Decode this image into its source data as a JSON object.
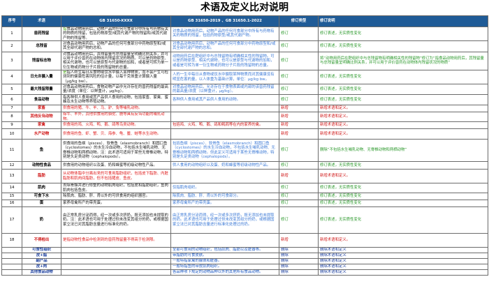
{
  "page": {
    "title": "术语及定义比对说明"
  },
  "headers": {
    "no": "序号",
    "term": "术语",
    "new_std": "GB 31650-XXXX",
    "old_std": "GB 31650-2019 、GB 31650.1-2022",
    "type": "修订类型",
    "note": "修订说明"
  },
  "colors": {
    "header_bg": "#1f5b97",
    "keyword_green": "#4ea81e",
    "added_red": "#d01818",
    "deleted_blue": "#1a3e9e",
    "modified_green": "#2e9a2e"
  },
  "rows": [
    {
      "no": "1",
      "term": "兽药残留",
      "new_pre": "",
      "new_kw": "指",
      "new_txt": "食品动物用药后，动物产品的任何可食部分中所有与药物有关的物质的残留，包括药物原型/或其代谢产物的残留和/或其代谢产物的残留等。",
      "old": "对食品动物用药后，动物产品的任何可食部分中所有与药物有关的物质的残留，包括药物原型/或其代谢产物。",
      "type": "修订",
      "note": "修订表述，无实质性变化",
      "status": "mod",
      "h": 13
    },
    {
      "no": "2",
      "term": "总残留",
      "new_pre": "",
      "new_kw": "",
      "new_txt": "对食品动物用药后，动物产品的任何可食部分中药物原型和/或其全部代谢产物的总和。",
      "old": "对食品动物用药后，动物产品的任何可食部分中药物原型和/或其全部代谢产物的总和。",
      "type": "修订",
      "note": "修订表述，无实质性变化",
      "status": "mod",
      "h": 14
    },
    {
      "no": "3",
      "term": "残留标志物",
      "new_pre": "",
      "new_kw": "",
      "new_txt": "对食品动物用药后，其残留量与总残留量呈明确比例关系，并可以用于评价兽药在动物体内残留状况的物质。可以是药物原型、相关代谢物，也可以是原型与代谢物的加和，或者是可转为单一衍生物或药物分子片段的残留物的总量。",
      "old": "动物用药后在靶组织中与总残留物有明确相关性的残留物。可以是药物原型、相关代谢物，也可以是原型与代谢物的加和，或者是可转为单一衍生物或药物分子片段的残留物的总量。",
      "type": "修订",
      "note": "将“动物用药后在靶组织中与总残留物有明确相关性的残留物”修订为“指食品动物用药后，其残留量与总残留量呈明确比例关系，并可以用于评价兽药在动物体内残留状况的物质”",
      "status": "mod",
      "h": 24
    },
    {
      "no": "4",
      "term": "日允许摄入量",
      "new_pre": "",
      "new_kw": "是",
      "new_txt": "指人终生每日从食物或饮水中摄入某种物质，而不会产生可检测到的健康危害风险的估计量，以每千克体重计算摄入量（μg/kg bw）。",
      "old": "人的一生中每日从食物或饮水中摄取某种物质而对其健康没有明显危害的量，以人体重为基础计算，单位：μg/kg bw。",
      "type": "修订",
      "note": "修订表述，无实质性变化",
      "status": "mod",
      "h": 18
    },
    {
      "no": "5",
      "term": "最大残留限量",
      "new_pre": "",
      "new_kw": "",
      "new_txt": "对食品动物用药后，食物动物产品中允许存在的兽药残留的最高量/浓度（单位：以鲜重计，μg/kg）。",
      "old": "对食品动物用药后，允许存在于食物表面或内部的该兽药残留的最高量/浓度（以鲜重计，μg/kg）。",
      "type": "修订",
      "note": "修订表述，无实质性变化",
      "status": "mod",
      "h": 13
    },
    {
      "no": "6",
      "term": "食品动物",
      "new_pre": "",
      "new_kw": "",
      "new_txt": "指各种供人食用或其产品供人食用的动物，包括家畜、家禽、蜜蜂及水生动物等养殖动物。",
      "old": "各种供人食用或其产品供人食用的动物。",
      "type": "修订",
      "note": "修订表述，无实质性变化",
      "status": "mod",
      "h": 13
    },
    {
      "no": "7",
      "term": "家畜",
      "new_pre": "",
      "new_kw": "",
      "new_txt": "供食用的猪、牛、羊、马、驴、兔等哺乳动物。",
      "old": "",
      "type": "新增",
      "note": "新增术语和定义。",
      "status": "new",
      "h": 8
    },
    {
      "no": "8",
      "term": "其他反刍动物",
      "new_pre": "",
      "new_kw": "",
      "new_txt": "除牛、羊外，其他供食用的骆驼、鹿等具有反刍功能的哺乳动物。",
      "old": "",
      "type": "新增",
      "note": "新增术语和定义。",
      "status": "new",
      "h": 12
    },
    {
      "no": "9",
      "term": "家禽",
      "new_pre": "",
      "new_kw": "",
      "new_txt": "供食用的鸡、火鸡、鸭、鹅、鸽等鸟类动物。",
      "old": "包括鸡、火鸡、鸭、鹅、鸽和鹌鹑等在内的家养的禽。",
      "type": "新增",
      "note": "新增术语和定义。",
      "status": "new",
      "h": 8
    },
    {
      "no": "10",
      "term": "水产动物",
      "new_pre": "",
      "new_kw": "",
      "new_txt": "供食用的鱼、虾、蟹、贝、海参、龟、鳖、蛙等水生动物。",
      "old": "",
      "type": "新增",
      "note": "新增术语和定义。",
      "status": "new",
      "h": 13
    },
    {
      "no": "11",
      "term": "鱼",
      "new_pre": "",
      "new_kw": "",
      "new_txt": "供食用的鱼纲（pisces）、软骨鱼（elasmobranch）和圆口鱼（cyclostomes）的水生冷血动物，不包括水生哺乳动物、无脊椎动物和两栖动物。注：此术语可适用于某些无脊椎动物，特别是头足类动物（cephalopods）。",
      "old": "包括鱼纲（pisces）、软骨鱼（elasmobranch）和圆口鱼（cyclostomes）的水生冷血动物，不包括水生哺乳动物、无脊椎动物和两栖动物。但此定义可适用于某些无脊椎动物，特别是头足类动物（cephalopods）。",
      "type": "修订",
      "note": "删除“不包括水生哺乳动物、无脊椎动物和两栖动物”",
      "status": "mod",
      "h": 30
    },
    {
      "no": "12",
      "term": "动物性食品",
      "new_pre": "",
      "new_kw": "",
      "new_txt": "供食用的动物组织以及蛋、奶和蜂蜜等初级动物性产品。",
      "old": "供人食用的动物组织以及蛋、奶和蜂蜜等初级动物性产品。",
      "type": "修订",
      "note": "修订表述，无实质性变化",
      "status": "mod",
      "h": 9
    },
    {
      "no": "13",
      "term": "脂肪",
      "new_pre": "",
      "new_kw": "",
      "new_txt": "从动物体脂中分离出来的可食用脂肪组织，包括皮下脂肪、内脏脂肪和肌肉间脂肪，但不包括猪皮、鱼皮。",
      "old": "",
      "type": "新增",
      "note": "新增术语和定义。",
      "status": "new",
      "h": 18
    },
    {
      "no": "14",
      "term": "肌肉",
      "new_pre": "",
      "new_kw": "",
      "new_txt": "去除骨骼并进行修整的动物肌肉组织，包括皮和脂肪组织，鱼肉肌肉包括鱼皮。",
      "old": "仅指肌肉组织。",
      "type": "修订",
      "note": "修订表述，无实质性变化",
      "status": "mod",
      "h": 12
    },
    {
      "no": "15",
      "term": "可食下水",
      "new_pre": "",
      "new_kw": "",
      "new_txt": "除肌肉、脂肪、肝、肾以外的可供食用的组织器官。",
      "old": "除肌肉、脂肪、肝、肾以外的可食部分。",
      "type": "修订",
      "note": "修订表述，无实质性变化",
      "status": "mod",
      "h": 8
    },
    {
      "no": "16",
      "term": "蛋",
      "new_pre": "",
      "new_kw": "",
      "new_txt": "家养母禽所产的带壳蛋。",
      "old": "家养母禽所产的带壳蛋。",
      "type": "修订",
      "note": "修订表述，无实质性变化",
      "status": "mod",
      "h": 8
    },
    {
      "no": "17",
      "term": "奶",
      "new_pre": "",
      "new_kw": "",
      "new_txt": "由正常乳房分泌而得，经一次或多次挤奶，既无添加也未提取的奶。注：此术语也可用于处理过但未改变其组分的奶，或根据国家立法已对其脂肪含量进行标准化的奶。",
      "old": "由正常乳房分泌而得，经一次或多次挤奶，既无添加也未提取的奶。此术语也可用于处理过但未改变其组分的奶，或根据国家立法已对其脂肪含量进行标准化处理过的奶。",
      "type": "修订",
      "note": "修订表述，无实质性变化",
      "status": "mod",
      "h": 36
    },
    {
      "no": "18",
      "term": "不得检出",
      "new_pre": "",
      "new_kw": "",
      "new_txt": "是指动物性食品中检测到的兽药残留量不得高于检测限。",
      "old": "",
      "type": "新增",
      "note": "新增术语和定义。",
      "status": "new",
      "h": 18
    },
    {
      "no": "",
      "term": "可食性组织",
      "new_pre": "",
      "new_kw": "",
      "new_txt": "",
      "old": "全部可食用的动物组织，包括肌肉、脂肪以及脏器等。",
      "type": "删除",
      "note": "删除术语和定义",
      "status": "del",
      "h": 6
    },
    {
      "no": "",
      "term": "皮+脂",
      "new_pre": "",
      "new_kw": "",
      "new_txt": "",
      "old": "带脂肪的可食皮肤。",
      "type": "删除",
      "note": "删除术语和定义",
      "status": "del",
      "h": 6
    },
    {
      "no": "",
      "term": "副产品",
      "new_pre": "",
      "new_kw": "",
      "new_txt": "",
      "old": "一般特指家禽的腺体和脏器。",
      "type": "删除",
      "note": "删除术语和定义",
      "status": "del",
      "h": 6
    },
    {
      "no": "",
      "term": "皮+肉",
      "new_pre": "",
      "new_kw": "",
      "new_txt": "",
      "old": "一般特指鱼的带皮肌肉组织。",
      "type": "删除",
      "note": "删除术语和定义",
      "status": "del",
      "h": 6
    },
    {
      "no": "",
      "term": "其他食品动物",
      "new_pre": "",
      "new_kw": "",
      "new_txt": "",
      "old": "各品种项下规定的动物品种以外的其他所有食品动物。",
      "type": "删除",
      "note": "删除术语和定义",
      "status": "del",
      "h": 6
    }
  ]
}
